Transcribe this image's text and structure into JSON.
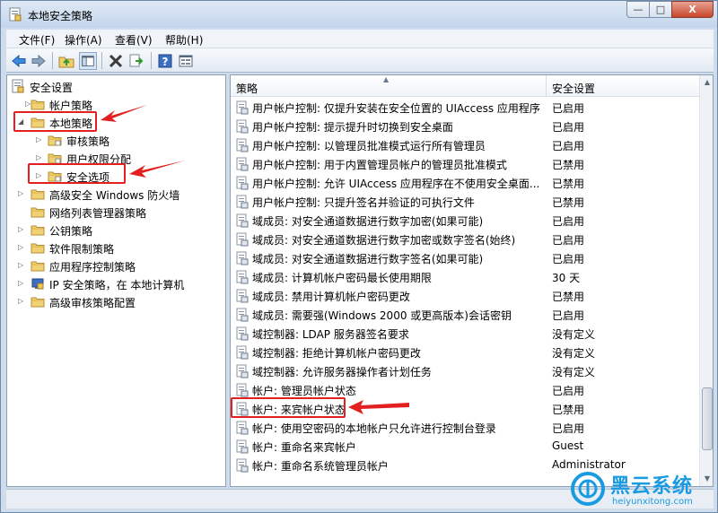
{
  "window": {
    "title": "本地安全策略",
    "controls": {
      "minimize": "—",
      "maximize": "□",
      "close": "X"
    }
  },
  "menu": [
    "文件(F)",
    "操作(A)",
    "查看(V)",
    "帮助(H)"
  ],
  "toolbar": [
    "back-icon",
    "forward-icon",
    "up-folder-icon",
    "show-tree-icon",
    "delete-icon",
    "export-icon",
    "help-icon",
    "properties-icon"
  ],
  "tree": {
    "root": "安全设置",
    "items": [
      {
        "label": "帐户策略",
        "icon": "folder-icon"
      },
      {
        "label": "本地策略",
        "icon": "folder-icon",
        "expanded": true
      },
      {
        "label": "审核策略",
        "icon": "folder-icon"
      },
      {
        "label": "用户权限分配",
        "icon": "folder-icon"
      },
      {
        "label": "安全选项",
        "icon": "folder-icon",
        "selected": true
      },
      {
        "label": "高级安全 Windows 防火墙",
        "icon": "folder-icon"
      },
      {
        "label": "网络列表管理器策略",
        "icon": "folder-icon"
      },
      {
        "label": "公钥策略",
        "icon": "folder-icon"
      },
      {
        "label": "软件限制策略",
        "icon": "folder-icon"
      },
      {
        "label": "应用程序控制策略",
        "icon": "folder-icon"
      },
      {
        "label": "IP 安全策略，在 本地计算机",
        "icon": "ip-security-icon"
      },
      {
        "label": "高级审核策略配置",
        "icon": "folder-icon"
      }
    ]
  },
  "table": {
    "columns": [
      "策略",
      "安全设置"
    ],
    "rows": [
      {
        "policy": "用户帐户控制: 仅提升安装在安全位置的 UIAccess 应用程序",
        "setting": "已启用"
      },
      {
        "policy": "用户帐户控制: 提示提升时切换到安全桌面",
        "setting": "已启用"
      },
      {
        "policy": "用户帐户控制: 以管理员批准模式运行所有管理员",
        "setting": "已启用"
      },
      {
        "policy": "用户帐户控制: 用于内置管理员帐户的管理员批准模式",
        "setting": "已禁用"
      },
      {
        "policy": "用户帐户控制: 允许 UIAccess 应用程序在不使用安全桌面...",
        "setting": "已禁用"
      },
      {
        "policy": "用户帐户控制: 只提升签名并验证的可执行文件",
        "setting": "已禁用"
      },
      {
        "policy": "域成员: 对安全通道数据进行数字加密(如果可能)",
        "setting": "已启用"
      },
      {
        "policy": "域成员: 对安全通道数据进行数字加密或数字签名(始终)",
        "setting": "已启用"
      },
      {
        "policy": "域成员: 对安全通道数据进行数字签名(如果可能)",
        "setting": "已启用"
      },
      {
        "policy": "域成员: 计算机帐户密码最长使用期限",
        "setting": "30 天"
      },
      {
        "policy": "域成员: 禁用计算机帐户密码更改",
        "setting": "已禁用"
      },
      {
        "policy": "域成员: 需要强(Windows 2000 或更高版本)会话密钥",
        "setting": "已启用"
      },
      {
        "policy": "域控制器: LDAP 服务器签名要求",
        "setting": "没有定义"
      },
      {
        "policy": "域控制器: 拒绝计算机帐户密码更改",
        "setting": "没有定义"
      },
      {
        "policy": "域控制器: 允许服务器操作者计划任务",
        "setting": "没有定义"
      },
      {
        "policy": "帐户: 管理员帐户状态",
        "setting": "已启用"
      },
      {
        "policy": "帐户: 来宾帐户状态",
        "setting": "已禁用"
      },
      {
        "policy": "帐户: 使用空密码的本地帐户只允许进行控制台登录",
        "setting": "已启用"
      },
      {
        "policy": "帐户: 重命名来宾帐户",
        "setting": "Guest"
      },
      {
        "policy": "帐户: 重命名系统管理员帐户",
        "setting": "Administrator"
      }
    ]
  },
  "watermark": {
    "title": "黑云系统",
    "url": "heiyunxitong.com"
  },
  "colors": {
    "highlight": "#e32020",
    "watermark": "#1a9ae0"
  }
}
